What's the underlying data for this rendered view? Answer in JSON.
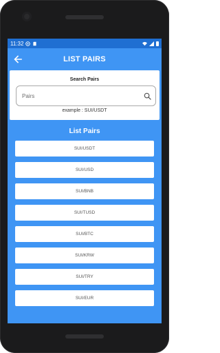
{
  "status_bar": {
    "time": "11:32"
  },
  "app_bar": {
    "title": "LIST PAIRS"
  },
  "search": {
    "title": "Search Pairs",
    "placeholder": "Pairs",
    "hint": "example : SUI/USDT"
  },
  "list": {
    "title": "List Pairs",
    "items": [
      "SUI/USDT",
      "SUI/USD",
      "SUI/BNB",
      "SUI/TUSD",
      "SUI/BTC",
      "SUI/KRW",
      "SUI/TRY",
      "SUI/EUR"
    ]
  },
  "colors": {
    "primary": "#3f95f4",
    "status_bar": "#1f6fd2",
    "frame": "#1b1b1c"
  },
  "icons": [
    "back-arrow-icon",
    "search-icon",
    "wifi-icon",
    "signal-icon",
    "battery-icon"
  ]
}
